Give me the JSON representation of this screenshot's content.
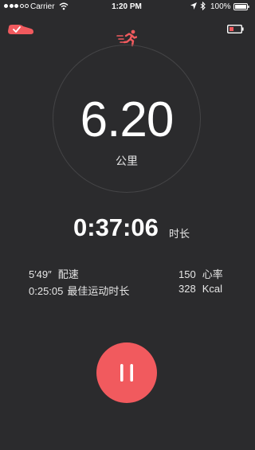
{
  "status_bar": {
    "carrier": "Carrier",
    "time": "1:20 PM",
    "battery_percent": "100%"
  },
  "icons": {
    "shoe": "shoe-icon",
    "runner": "runner-icon",
    "device_battery": "low-battery-icon"
  },
  "colors": {
    "accent": "#f15a5e",
    "background": "#2b2b2d"
  },
  "run": {
    "distance": "6.20",
    "distance_unit": "公里",
    "duration": "0:37:06",
    "duration_unit": "时长"
  },
  "stats": {
    "pace_value": "5′49″",
    "pace_label": "配速",
    "best_value": "0:25:05",
    "best_label": "最佳运动时长",
    "heart_rate_value": "150",
    "heart_rate_label": "心率",
    "calories_value": "328",
    "calories_label": "Kcal"
  },
  "controls": {
    "pause_icon": "pause-icon"
  }
}
